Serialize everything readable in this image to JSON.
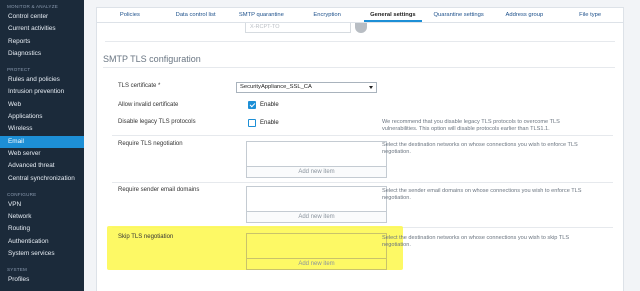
{
  "sidebar": {
    "sections": [
      {
        "title": "MONITOR & ANALYZE",
        "items": [
          "Control center",
          "Current activities",
          "Reports",
          "Diagnostics"
        ]
      },
      {
        "title": "PROTECT",
        "items": [
          "Rules and policies",
          "Intrusion prevention",
          "Web",
          "Applications",
          "Wireless",
          "Email",
          "Web server",
          "Advanced threat",
          "Central synchronization"
        ]
      },
      {
        "title": "CONFIGURE",
        "items": [
          "VPN",
          "Network",
          "Routing",
          "Authentication",
          "System services"
        ]
      },
      {
        "title": "SYSTEM",
        "items": [
          "Profiles"
        ]
      }
    ],
    "active_item": "Email"
  },
  "tabs": [
    "Policies",
    "Data control list",
    "SMTP quarantine",
    "Encryption",
    "General settings",
    "Quarantine settings",
    "Address group",
    "File type"
  ],
  "active_tab": "General settings",
  "top_field": {
    "value": "X-RCPT-TO"
  },
  "section": {
    "title": "SMTP TLS configuration",
    "tls_certificate": {
      "label": "TLS certificate *",
      "value": "SecurityAppliance_SSL_CA"
    },
    "allow_invalid": {
      "label": "Allow invalid certificate",
      "checkbox_label": "Enable",
      "checked": true
    },
    "disable_legacy": {
      "label": "Disable legacy TLS protocols",
      "checkbox_label": "Enable",
      "checked": false,
      "help": "We recommend that you disable legacy TLS protocols to overcome TLS vulnerabilities. This option will disable protocols earlier than TLS1.1."
    },
    "require_tls": {
      "label": "Require TLS negotiation",
      "add_label": "Add new item",
      "help": "Select the destination networks on whose connections you wish to enforce TLS negotiation."
    },
    "require_sender": {
      "label": "Require sender email domains",
      "add_label": "Add new item",
      "help": "Select the sender email domains on whose connections you wish to enforce TLS negotiation."
    },
    "skip_tls": {
      "label": "Skip TLS negotiation",
      "add_label": "Add new item",
      "help": "Select the destination networks on whose connections you wish to skip TLS negotiation."
    }
  },
  "colors": {
    "sidebar_bg": "#1b2a3a",
    "accent": "#1d8fd6",
    "highlight": "#fdf84a"
  }
}
